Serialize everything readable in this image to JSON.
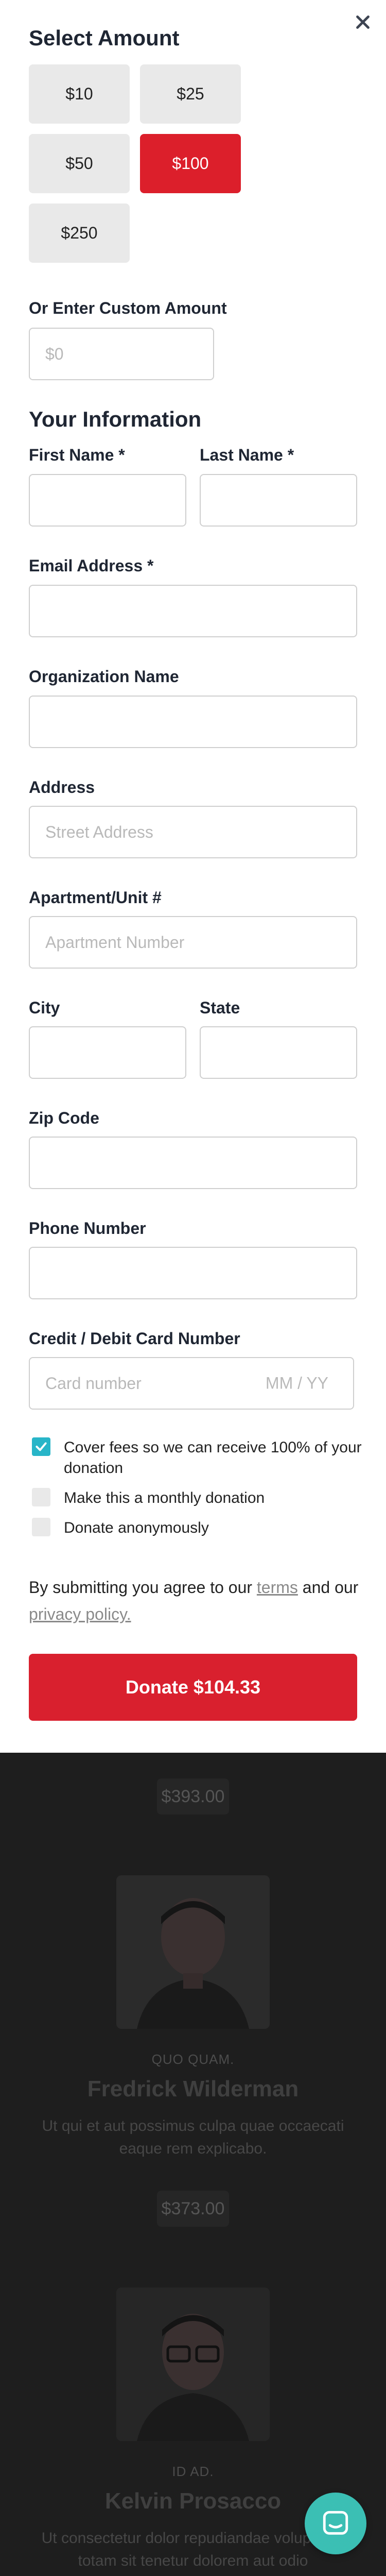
{
  "amounts": {
    "heading": "Select Amount",
    "options": [
      "$10",
      "$25",
      "$50",
      "$100",
      "$250"
    ],
    "selected": "$100",
    "custom_label": "Or Enter Custom Amount",
    "custom_placeholder": "$0"
  },
  "info": {
    "heading": "Your Information",
    "first_name_label": "First Name *",
    "last_name_label": "Last Name *",
    "email_label": "Email Address *",
    "org_label": "Organization Name",
    "address_label": "Address",
    "address_placeholder": "Street Address",
    "apt_label": "Apartment/Unit #",
    "apt_placeholder": "Apartment Number",
    "city_label": "City",
    "state_label": "State",
    "zip_label": "Zip Code",
    "phone_label": "Phone Number",
    "card_label": "Credit / Debit Card Number",
    "card_placeholder": "Card number",
    "expiry_placeholder": "MM / YY"
  },
  "options": {
    "cover_fees": "Cover fees so we can receive 100% of your donation",
    "cover_fees_checked": true,
    "monthly": "Make this a monthly donation",
    "monthly_checked": false,
    "anonymous": "Donate anonymously",
    "anonymous_checked": false
  },
  "agreement": {
    "prefix": "By submitting you agree to our",
    "terms": "terms",
    "and": "and our",
    "privacy": "privacy policy."
  },
  "donate_button": "Donate $104.33",
  "background": {
    "price1": "$393.00",
    "person1_role": "QUO QUAM.",
    "person1_name": "Fredrick Wilderman",
    "person1_desc": "Ut qui et aut possimus culpa quae occaecati eaque rem explicabo.",
    "price2": "$373.00",
    "person2_role": "ID AD.",
    "person2_name": "Kelvin Prosacco",
    "person2_desc": "Ut consectetur dolor repudiandae voluptates totam sit tenetur dolorem aut odio"
  },
  "colors": {
    "accent_red": "#dc1f2b",
    "checkbox_teal": "#28b5c8",
    "chat_teal": "#3bbfb4",
    "overlay": "#1e1e1e"
  },
  "icons": {
    "close": "close-icon",
    "chat": "chat-icon",
    "check": "check-icon"
  }
}
